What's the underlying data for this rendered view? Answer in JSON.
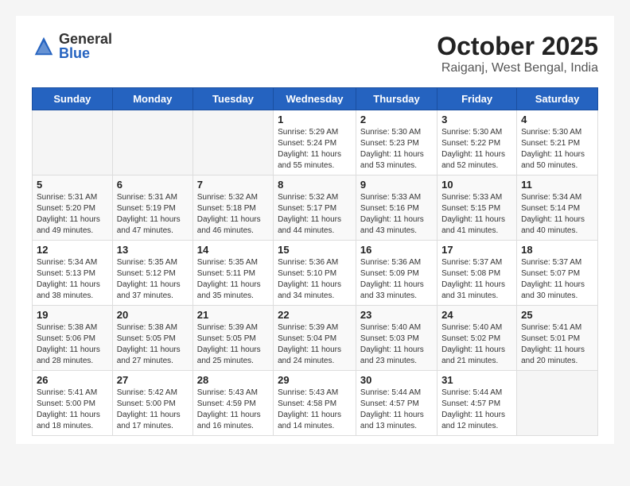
{
  "header": {
    "logo_general": "General",
    "logo_blue": "Blue",
    "month": "October 2025",
    "location": "Raiganj, West Bengal, India"
  },
  "weekdays": [
    "Sunday",
    "Monday",
    "Tuesday",
    "Wednesday",
    "Thursday",
    "Friday",
    "Saturday"
  ],
  "weeks": [
    [
      {
        "day": "",
        "info": ""
      },
      {
        "day": "",
        "info": ""
      },
      {
        "day": "",
        "info": ""
      },
      {
        "day": "1",
        "info": "Sunrise: 5:29 AM\nSunset: 5:24 PM\nDaylight: 11 hours\nand 55 minutes."
      },
      {
        "day": "2",
        "info": "Sunrise: 5:30 AM\nSunset: 5:23 PM\nDaylight: 11 hours\nand 53 minutes."
      },
      {
        "day": "3",
        "info": "Sunrise: 5:30 AM\nSunset: 5:22 PM\nDaylight: 11 hours\nand 52 minutes."
      },
      {
        "day": "4",
        "info": "Sunrise: 5:30 AM\nSunset: 5:21 PM\nDaylight: 11 hours\nand 50 minutes."
      }
    ],
    [
      {
        "day": "5",
        "info": "Sunrise: 5:31 AM\nSunset: 5:20 PM\nDaylight: 11 hours\nand 49 minutes."
      },
      {
        "day": "6",
        "info": "Sunrise: 5:31 AM\nSunset: 5:19 PM\nDaylight: 11 hours\nand 47 minutes."
      },
      {
        "day": "7",
        "info": "Sunrise: 5:32 AM\nSunset: 5:18 PM\nDaylight: 11 hours\nand 46 minutes."
      },
      {
        "day": "8",
        "info": "Sunrise: 5:32 AM\nSunset: 5:17 PM\nDaylight: 11 hours\nand 44 minutes."
      },
      {
        "day": "9",
        "info": "Sunrise: 5:33 AM\nSunset: 5:16 PM\nDaylight: 11 hours\nand 43 minutes."
      },
      {
        "day": "10",
        "info": "Sunrise: 5:33 AM\nSunset: 5:15 PM\nDaylight: 11 hours\nand 41 minutes."
      },
      {
        "day": "11",
        "info": "Sunrise: 5:34 AM\nSunset: 5:14 PM\nDaylight: 11 hours\nand 40 minutes."
      }
    ],
    [
      {
        "day": "12",
        "info": "Sunrise: 5:34 AM\nSunset: 5:13 PM\nDaylight: 11 hours\nand 38 minutes."
      },
      {
        "day": "13",
        "info": "Sunrise: 5:35 AM\nSunset: 5:12 PM\nDaylight: 11 hours\nand 37 minutes."
      },
      {
        "day": "14",
        "info": "Sunrise: 5:35 AM\nSunset: 5:11 PM\nDaylight: 11 hours\nand 35 minutes."
      },
      {
        "day": "15",
        "info": "Sunrise: 5:36 AM\nSunset: 5:10 PM\nDaylight: 11 hours\nand 34 minutes."
      },
      {
        "day": "16",
        "info": "Sunrise: 5:36 AM\nSunset: 5:09 PM\nDaylight: 11 hours\nand 33 minutes."
      },
      {
        "day": "17",
        "info": "Sunrise: 5:37 AM\nSunset: 5:08 PM\nDaylight: 11 hours\nand 31 minutes."
      },
      {
        "day": "18",
        "info": "Sunrise: 5:37 AM\nSunset: 5:07 PM\nDaylight: 11 hours\nand 30 minutes."
      }
    ],
    [
      {
        "day": "19",
        "info": "Sunrise: 5:38 AM\nSunset: 5:06 PM\nDaylight: 11 hours\nand 28 minutes."
      },
      {
        "day": "20",
        "info": "Sunrise: 5:38 AM\nSunset: 5:05 PM\nDaylight: 11 hours\nand 27 minutes."
      },
      {
        "day": "21",
        "info": "Sunrise: 5:39 AM\nSunset: 5:05 PM\nDaylight: 11 hours\nand 25 minutes."
      },
      {
        "day": "22",
        "info": "Sunrise: 5:39 AM\nSunset: 5:04 PM\nDaylight: 11 hours\nand 24 minutes."
      },
      {
        "day": "23",
        "info": "Sunrise: 5:40 AM\nSunset: 5:03 PM\nDaylight: 11 hours\nand 23 minutes."
      },
      {
        "day": "24",
        "info": "Sunrise: 5:40 AM\nSunset: 5:02 PM\nDaylight: 11 hours\nand 21 minutes."
      },
      {
        "day": "25",
        "info": "Sunrise: 5:41 AM\nSunset: 5:01 PM\nDaylight: 11 hours\nand 20 minutes."
      }
    ],
    [
      {
        "day": "26",
        "info": "Sunrise: 5:41 AM\nSunset: 5:00 PM\nDaylight: 11 hours\nand 18 minutes."
      },
      {
        "day": "27",
        "info": "Sunrise: 5:42 AM\nSunset: 5:00 PM\nDaylight: 11 hours\nand 17 minutes."
      },
      {
        "day": "28",
        "info": "Sunrise: 5:43 AM\nSunset: 4:59 PM\nDaylight: 11 hours\nand 16 minutes."
      },
      {
        "day": "29",
        "info": "Sunrise: 5:43 AM\nSunset: 4:58 PM\nDaylight: 11 hours\nand 14 minutes."
      },
      {
        "day": "30",
        "info": "Sunrise: 5:44 AM\nSunset: 4:57 PM\nDaylight: 11 hours\nand 13 minutes."
      },
      {
        "day": "31",
        "info": "Sunrise: 5:44 AM\nSunset: 4:57 PM\nDaylight: 11 hours\nand 12 minutes."
      },
      {
        "day": "",
        "info": ""
      }
    ]
  ]
}
